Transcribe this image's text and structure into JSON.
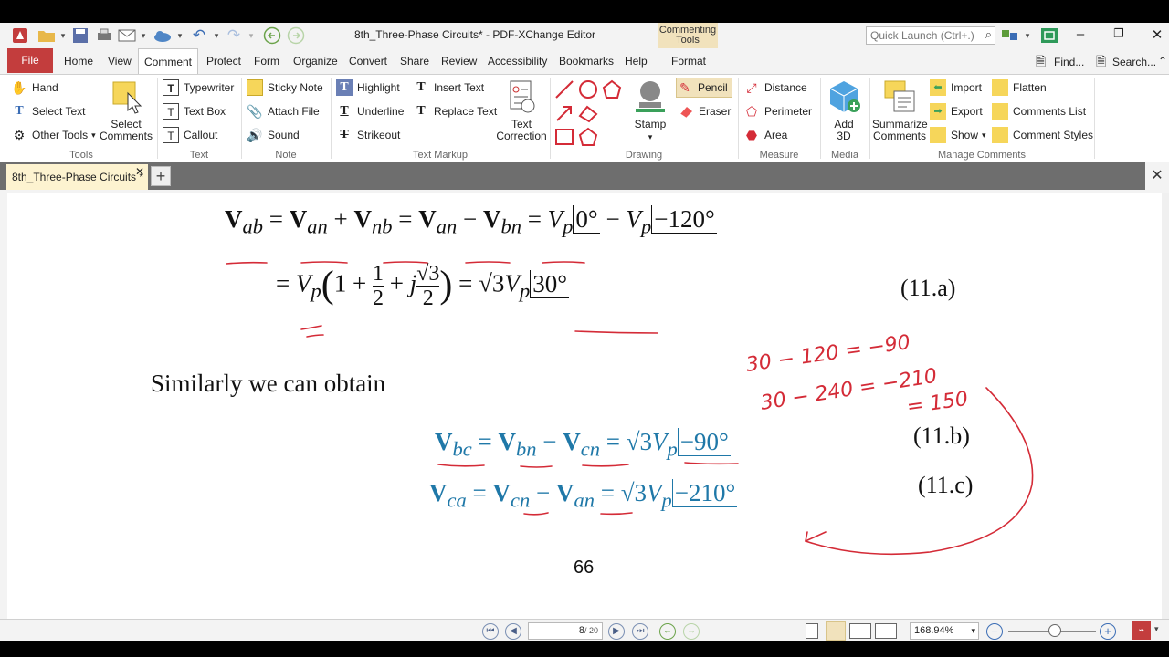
{
  "window": {
    "title": "8th_Three-Phase Circuits* - PDF-XChange Editor",
    "context_tab_title": "Commenting Tools",
    "quick_launch_placeholder": "Quick Launch (Ctrl+.)"
  },
  "menu": {
    "file": "File",
    "items": [
      "Home",
      "View",
      "Comment",
      "Protect",
      "Form",
      "Organize",
      "Convert",
      "Share",
      "Review",
      "Accessibility",
      "Bookmarks",
      "Help",
      "Format"
    ],
    "active": "Comment",
    "find": "Find...",
    "search": "Search..."
  },
  "ribbon": {
    "tools": {
      "label": "Tools",
      "hand": "Hand",
      "select_text": "Select Text",
      "other_tools": "Other Tools"
    },
    "select_comments": {
      "line1": "Select",
      "line2": "Comments"
    },
    "text": {
      "label": "Text",
      "typewriter": "Typewriter",
      "text_box": "Text Box",
      "callout": "Callout"
    },
    "note": {
      "label": "Note",
      "sticky_note": "Sticky Note",
      "attach_file": "Attach File",
      "sound": "Sound"
    },
    "text_markup": {
      "label": "Text Markup",
      "highlight": "Highlight",
      "underline": "Underline",
      "strikeout": "Strikeout",
      "insert_text": "Insert Text",
      "replace_text": "Replace Text",
      "text_correction_1": "Text",
      "text_correction_2": "Correction"
    },
    "drawing": {
      "label": "Drawing",
      "stamp": "Stamp",
      "pencil": "Pencil",
      "eraser": "Eraser"
    },
    "measure": {
      "label": "Measure",
      "distance": "Distance",
      "perimeter": "Perimeter",
      "area": "Area"
    },
    "media": {
      "label": "Media",
      "add3d_1": "Add",
      "add3d_2": "3D"
    },
    "manage": {
      "label": "Manage Comments",
      "summarize_1": "Summarize",
      "summarize_2": "Comments",
      "import": "Import",
      "export": "Export",
      "show": "Show",
      "flatten": "Flatten",
      "comments_list": "Comments List",
      "comment_styles": "Comment Styles"
    }
  },
  "document_tab": {
    "name": "8th_Three-Phase Circuits *"
  },
  "page": {
    "eq11a_num": "(11.a)",
    "similarly": "Similarly we can obtain",
    "eq11b_num": "(11.b)",
    "eq11c_num": "(11.c)",
    "page_number": "66",
    "handwriting": [
      "30 − 120 = −90",
      "30 − 240 = −210",
      "= 150"
    ]
  },
  "status": {
    "page_current": "8",
    "page_total": "/ 20",
    "zoom": "168.94%"
  },
  "colors": {
    "file_tab": "#c33d3d",
    "context_tab": "#f1e2bc",
    "doc_tab": "#fdf3d0",
    "ink": "#d42b37",
    "equation_blue": "#1f78a8"
  }
}
